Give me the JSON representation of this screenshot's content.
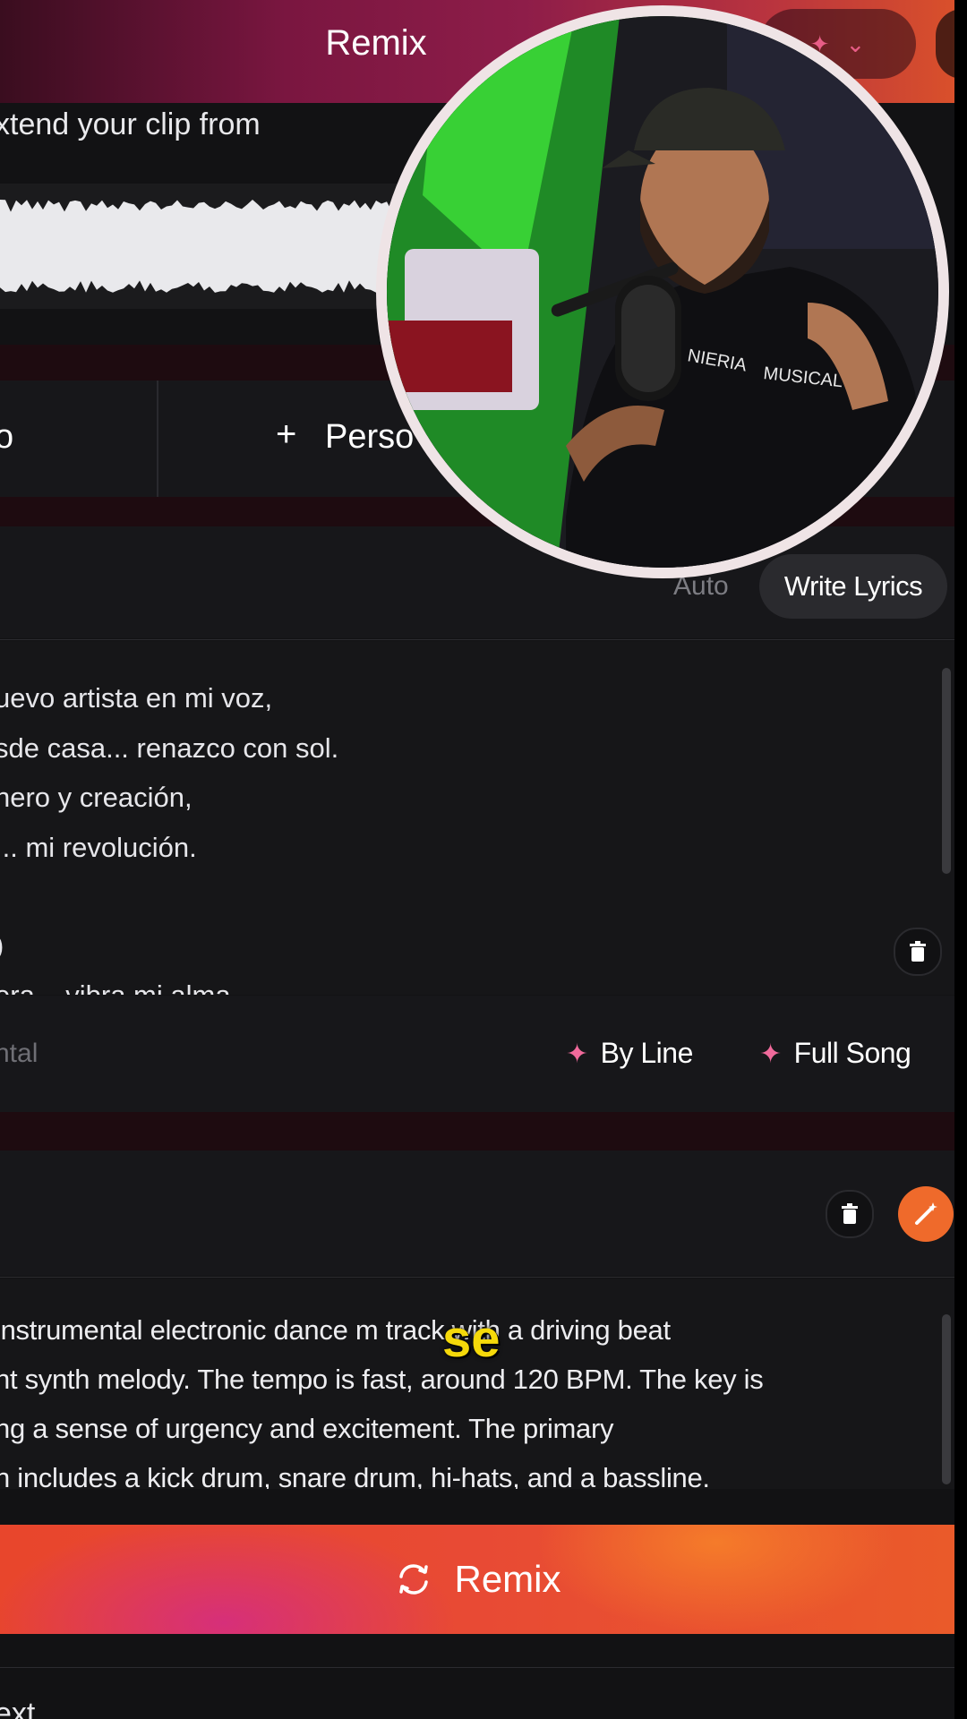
{
  "header": {
    "title": "Remix"
  },
  "extend": {
    "text": "xtend your clip from"
  },
  "buttons": {
    "left_label": "o",
    "persona_label": "Perso"
  },
  "lyrics": {
    "auto_label": "Auto",
    "write_lyrics_label": "Write Lyrics",
    "lines": [
      "uevo artista en mi voz,",
      "sde casa... renazco con sol.",
      "nero y creación,",
      "... mi revolución.",
      ")",
      "era... vibra mi alma..."
    ],
    "instrumental_label": "ntal",
    "by_line_label": "By Line",
    "full_song_label": "Full Song"
  },
  "style": {
    "lines": [
      "instrumental electronic dance m    track with a driving beat",
      "nt synth melody. The tempo is fast, around 120 BPM. The key is",
      "ng a sense of urgency and excitement. The primary",
      "n includes a kick drum, snare drum, hi-hats, and a bassline."
    ]
  },
  "caption": {
    "text": "se"
  },
  "remix_button": {
    "label": "Remix"
  },
  "bottom": {
    "text": "ext"
  },
  "icons": {
    "plus": "plus-icon",
    "trash": "trash-icon",
    "sparkle": "sparkle-icon",
    "magic_wand": "magic-wand-icon",
    "remix": "refresh-icon"
  },
  "colors": {
    "accent_orange": "#ef6a2b",
    "accent_pink": "#f06a9b",
    "caption_yellow": "#f5d90a"
  }
}
